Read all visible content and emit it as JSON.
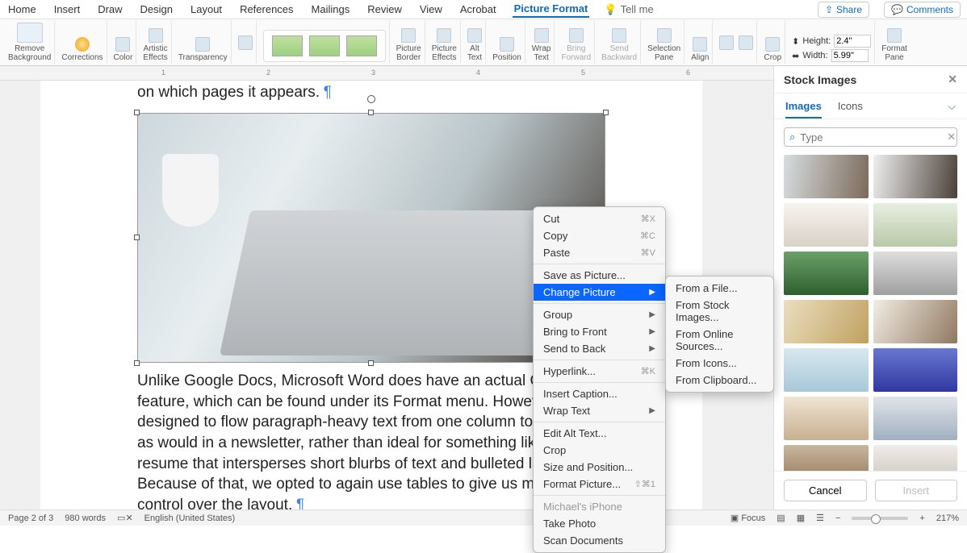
{
  "menubar": {
    "items": [
      "Home",
      "Insert",
      "Draw",
      "Design",
      "Layout",
      "References",
      "Mailings",
      "Review",
      "View",
      "Acrobat",
      "Picture Format"
    ],
    "active_index": 10,
    "tell_me": "Tell me",
    "share": "Share",
    "comments": "Comments"
  },
  "ribbon": {
    "remove_bg": "Remove\nBackground",
    "corrections": "Corrections",
    "color": "Color",
    "artistic": "Artistic\nEffects",
    "transparency": "Transparency",
    "picture_border": "Picture\nBorder",
    "picture_effects": "Picture\nEffects",
    "alt_text": "Alt\nText",
    "position": "Position",
    "wrap_text": "Wrap\nText",
    "bring_forward": "Bring\nForward",
    "send_backward": "Send\nBackward",
    "selection_pane": "Selection\nPane",
    "align": "Align",
    "crop": "Crop",
    "height_label": "Height:",
    "height_value": "2.4\"",
    "width_label": "Width:",
    "width_value": "5.99\"",
    "format_pane": "Format\nPane"
  },
  "document": {
    "partial_line": "on which pages it appears.",
    "body_text": "Unlike Google Docs, Microsoft Word does have an actual Columns feature, which can be found under its Format menu. However, it's designed to flow paragraph-heavy text from one column to the next, as would in a newsletter, rather than ideal for something like a resume that intersperses short blurbs of text and bulleted lists. Because of that, we opted to again use tables to give us more control over the layout."
  },
  "context_menu": {
    "cut": "Cut",
    "cut_sc": "⌘X",
    "copy": "Copy",
    "copy_sc": "⌘C",
    "paste": "Paste",
    "paste_sc": "⌘V",
    "save_as": "Save as Picture...",
    "change": "Change Picture",
    "group": "Group",
    "bring_front": "Bring to Front",
    "send_back": "Send to Back",
    "hyperlink": "Hyperlink...",
    "hyperlink_sc": "⌘K",
    "insert_caption": "Insert Caption...",
    "wrap_text": "Wrap Text",
    "edit_alt": "Edit Alt Text...",
    "crop": "Crop",
    "size_pos": "Size and Position...",
    "format_pic": "Format Picture...",
    "format_pic_sc": "⇧⌘1",
    "iphone": "Michael's iPhone",
    "take_photo": "Take Photo",
    "scan_docs": "Scan Documents"
  },
  "submenu": {
    "from_file": "From a File...",
    "from_stock": "From Stock Images...",
    "from_online": "From Online Sources...",
    "from_icons": "From Icons...",
    "from_clipboard": "From Clipboard..."
  },
  "pane": {
    "title": "Stock Images",
    "tab_images": "Images",
    "tab_icons": "Icons",
    "search_placeholder": "Type",
    "cancel": "Cancel",
    "insert": "Insert"
  },
  "status": {
    "page": "Page 2 of 3",
    "words": "980 words",
    "lang": "English (United States)",
    "focus": "Focus",
    "zoom": "217%"
  }
}
